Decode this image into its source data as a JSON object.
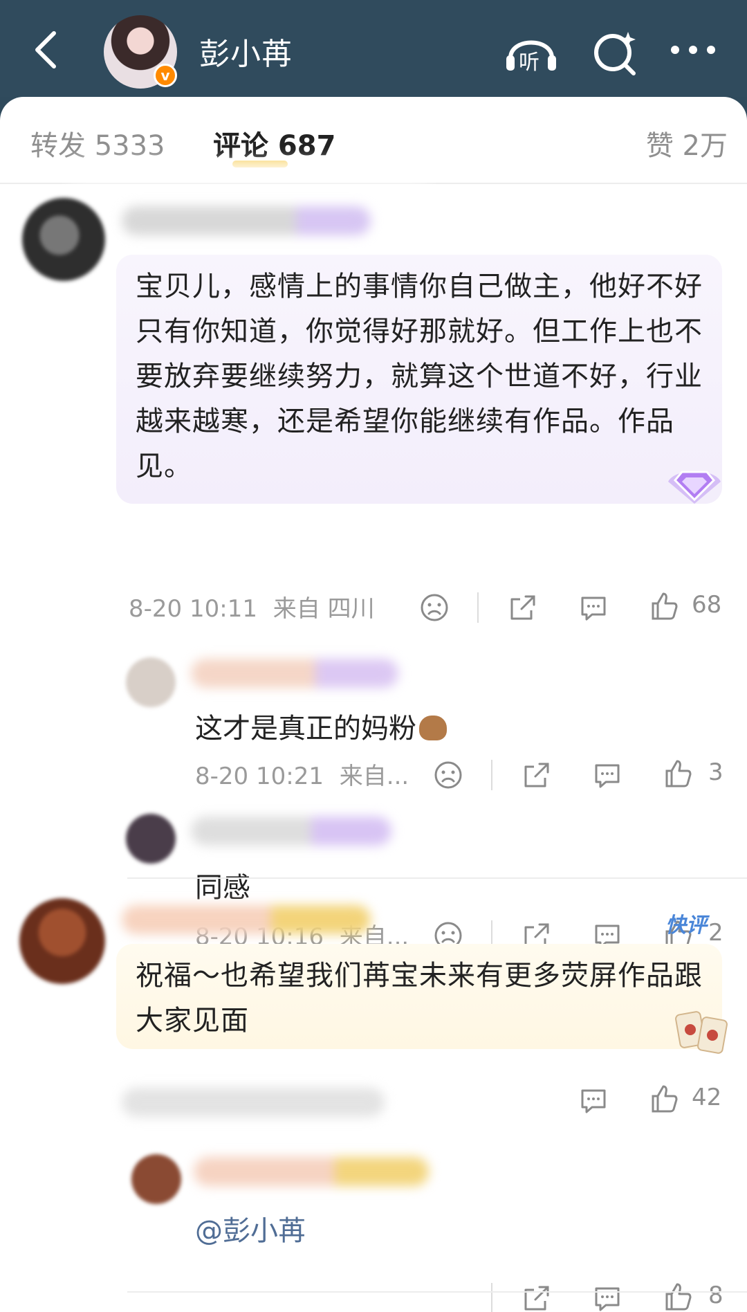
{
  "header": {
    "title": "彭小苒",
    "listen_label": "听",
    "verified_label": "v"
  },
  "tabs": {
    "repost": "转发 5333",
    "comment": "评论 687",
    "like": "赞 2万"
  },
  "comments": [
    {
      "text": "宝贝儿，感情上的事情你自己做主，他好不好只有你知道，你觉得好那就好。但工作上也不要放弃要继续努力，就算这个世道不好，行业越来越寒，还是希望你能继续有作品。作品见。",
      "time": "8-20 10:11",
      "location": "来自 四川",
      "likes": "68",
      "replies": [
        {
          "text": "这才是真正的妈粉",
          "time": "8-20 10:21",
          "location": "来自...",
          "likes": "3"
        },
        {
          "text": "同感",
          "time": "8-20 10:16",
          "location": "来自...",
          "likes": "2"
        }
      ]
    },
    {
      "badge": "快评",
      "text": "祝福～也希望我们苒宝未来有更多荧屏作品跟大家见面",
      "likes": "42",
      "replies": [
        {
          "text": "@彭小苒",
          "likes": "8"
        }
      ]
    }
  ],
  "icons": [
    "back-icon",
    "listen-icon",
    "search-icon",
    "more-icon",
    "dislike-icon",
    "share-icon",
    "comment-icon",
    "like-icon",
    "diamond-badge-icon",
    "mahjong-badge-icon",
    "capybara-emoji-icon"
  ],
  "colors": {
    "header_bg": "#304b5d",
    "accent_yellow": "#f7c948",
    "mention_blue": "#506d95",
    "bubble_purple": "#f5f0fb",
    "bubble_yellow": "#fff9ea"
  }
}
